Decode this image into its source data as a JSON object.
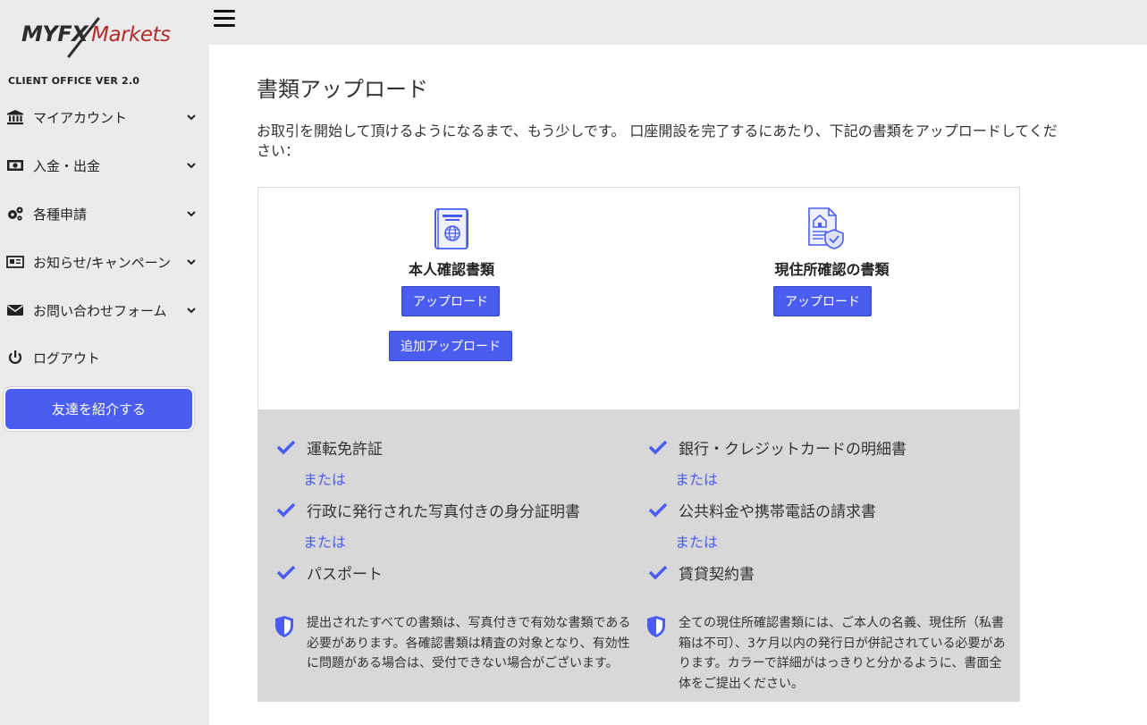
{
  "brand": {
    "logo_primary": "MYFX",
    "logo_secondary": "Markets",
    "version": "CLIENT OFFICE VER 2.0"
  },
  "sidebar": {
    "items": [
      {
        "label": "マイアカウント",
        "icon": "bank-icon",
        "expandable": true
      },
      {
        "label": "入金・出金",
        "icon": "money-icon",
        "expandable": true
      },
      {
        "label": "各種申請",
        "icon": "gears-icon",
        "expandable": true
      },
      {
        "label": "お知らせ/キャンペーン",
        "icon": "newspaper-icon",
        "expandable": true
      },
      {
        "label": "お問い合わせフォーム",
        "icon": "envelope-icon",
        "expandable": true
      },
      {
        "label": "ログアウト",
        "icon": "power-icon",
        "expandable": false
      }
    ],
    "referral_button": "友達を紹介する"
  },
  "topbar": {
    "menu_icon": "hamburger-icon"
  },
  "main": {
    "title": "書類アップロード",
    "intro": "お取引を開始して頂けるようになるまで、もう少しです。 口座開設を完了するにあたり、下記の書類をアップロードしてください：",
    "identity": {
      "heading": "本人確認書類",
      "upload_label": "アップロード",
      "extra_upload_label": "追加アップロード",
      "icon": "passport-icon",
      "items": [
        "運転免許証",
        "行政に発行された写真付きの身分証明書",
        "パスポート"
      ],
      "or_text": "または",
      "note": "提出されたすべての書類は、写真付きで有効な書類である必要があります。各確認書類は精査の対象となり、有効性に問題がある場合は、受付できない場合がございます。"
    },
    "address": {
      "heading": "現住所確認の書類",
      "upload_label": "アップロード",
      "icon": "address-document-icon",
      "items": [
        "銀行・クレジットカードの明細書",
        "公共料金や携帯電話の請求書",
        "賃貸契約書"
      ],
      "or_text": "または",
      "note": "全ての現住所確認書類には、ご本人の名義、現住所（私書箱は不可）、3ケ月以内の発行日が併記されている必要があります。カラーで詳細がはっきりと分かるように、書面全体をご提出ください。"
    }
  },
  "colors": {
    "accent": "#4a5df0",
    "sidebar_bg": "#ebebeb",
    "list_bg": "#d8d8d8",
    "logo_red": "#b52a2a"
  }
}
